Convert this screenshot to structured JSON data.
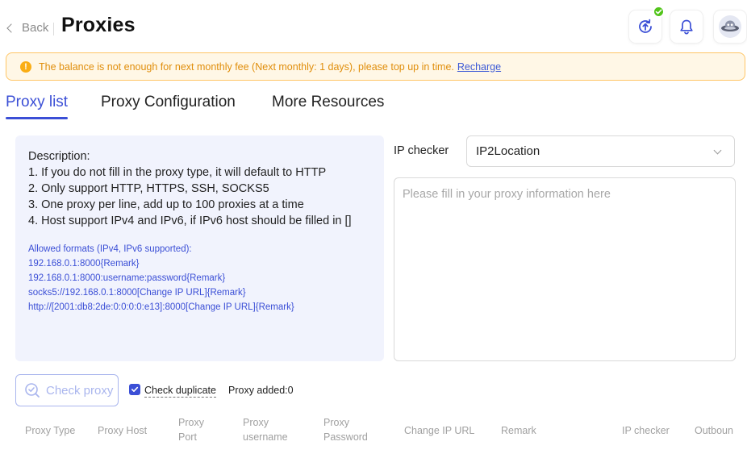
{
  "header": {
    "back_label": "Back",
    "title": "Proxies",
    "buttons": [
      {
        "icon": "upload-sync-icon",
        "badge": "check"
      },
      {
        "icon": "bell-icon"
      },
      {
        "icon": "avatar-icon"
      }
    ]
  },
  "alert": {
    "icon": "exclamation-icon",
    "message": "The balance is not enough for next monthly fee (Next monthly: 1 days), please top up in time.",
    "link": "Recharge",
    "colors": {
      "background": "#fff7e6",
      "border": "#ffc566",
      "text": "#e08e0b"
    }
  },
  "tabs": [
    {
      "label": "Proxy list",
      "active": true
    },
    {
      "label": "Proxy Configuration",
      "active": false
    },
    {
      "label": "More Resources",
      "active": false
    }
  ],
  "description": {
    "lines": [
      "Description:",
      "1. If you do not fill in the proxy type, it will default to HTTP",
      "2. Only support HTTP, HTTPS, SSH, SOCKS5",
      "3. One proxy per line, add up to 100 proxies at a time",
      "4. Host support IPv4 and IPv6, if IPv6 host should be filled in []"
    ],
    "formats": [
      "Allowed formats (IPv4, IPv6 supported):",
      "192.168.0.1:8000{Remark}",
      "192.168.0.1:8000:username:password{Remark}",
      "socks5://192.168.0.1:8000[Change IP URL]{Remark}",
      "http://[2001:db8:2de:0:0:0:0:e13]:8000[Change IP URL]{Remark}"
    ]
  },
  "ip_checker": {
    "label": "IP checker",
    "selected": "IP2Location"
  },
  "proxy_input": {
    "placeholder": "Please fill in your proxy information here",
    "value": ""
  },
  "actions": {
    "check_proxy": "Check proxy",
    "check_duplicate": "Check duplicate",
    "check_duplicate_checked": true,
    "proxy_added": "Proxy added:0"
  },
  "table": {
    "columns": [
      [
        "Proxy Type"
      ],
      [
        "Proxy Host"
      ],
      [
        "Proxy",
        "Port"
      ],
      [
        "Proxy",
        "username"
      ],
      [
        "Proxy",
        "Password"
      ],
      [
        "Change IP URL"
      ],
      [
        "Remark"
      ],
      [
        "IP checker"
      ],
      [
        "Outboun"
      ]
    ]
  },
  "colors": {
    "accent": "#3b4fd6",
    "success": "#52c41a",
    "warning": "#faad14"
  }
}
